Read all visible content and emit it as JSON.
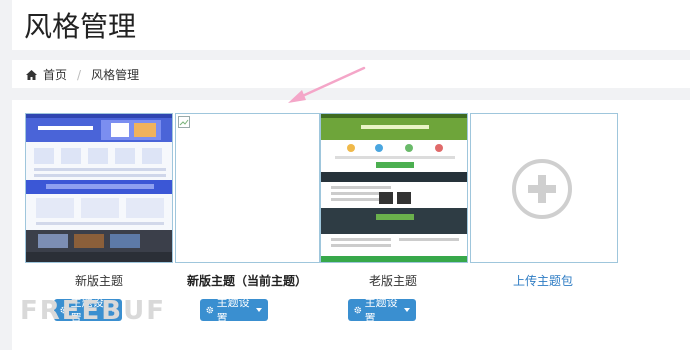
{
  "page": {
    "title": "风格管理"
  },
  "breadcrumb": {
    "home": "首页",
    "separator": "/",
    "current": "风格管理"
  },
  "themes": [
    {
      "label": "新版主题",
      "button": "主题设置",
      "image": "theme-preview-new"
    },
    {
      "label": "新版主题（当前主题）",
      "button": "主题设置",
      "image": "broken-image"
    },
    {
      "label": "老版主题",
      "button": "主题设置",
      "image": "theme-preview-old"
    }
  ],
  "upload": {
    "label": "上传主题包",
    "icon": "plus-circle-icon"
  },
  "watermark": "FREEBUF",
  "colors": {
    "accent": "#3a8fd0",
    "link": "#2e7cc4",
    "arrow": "#f4a6c8"
  }
}
